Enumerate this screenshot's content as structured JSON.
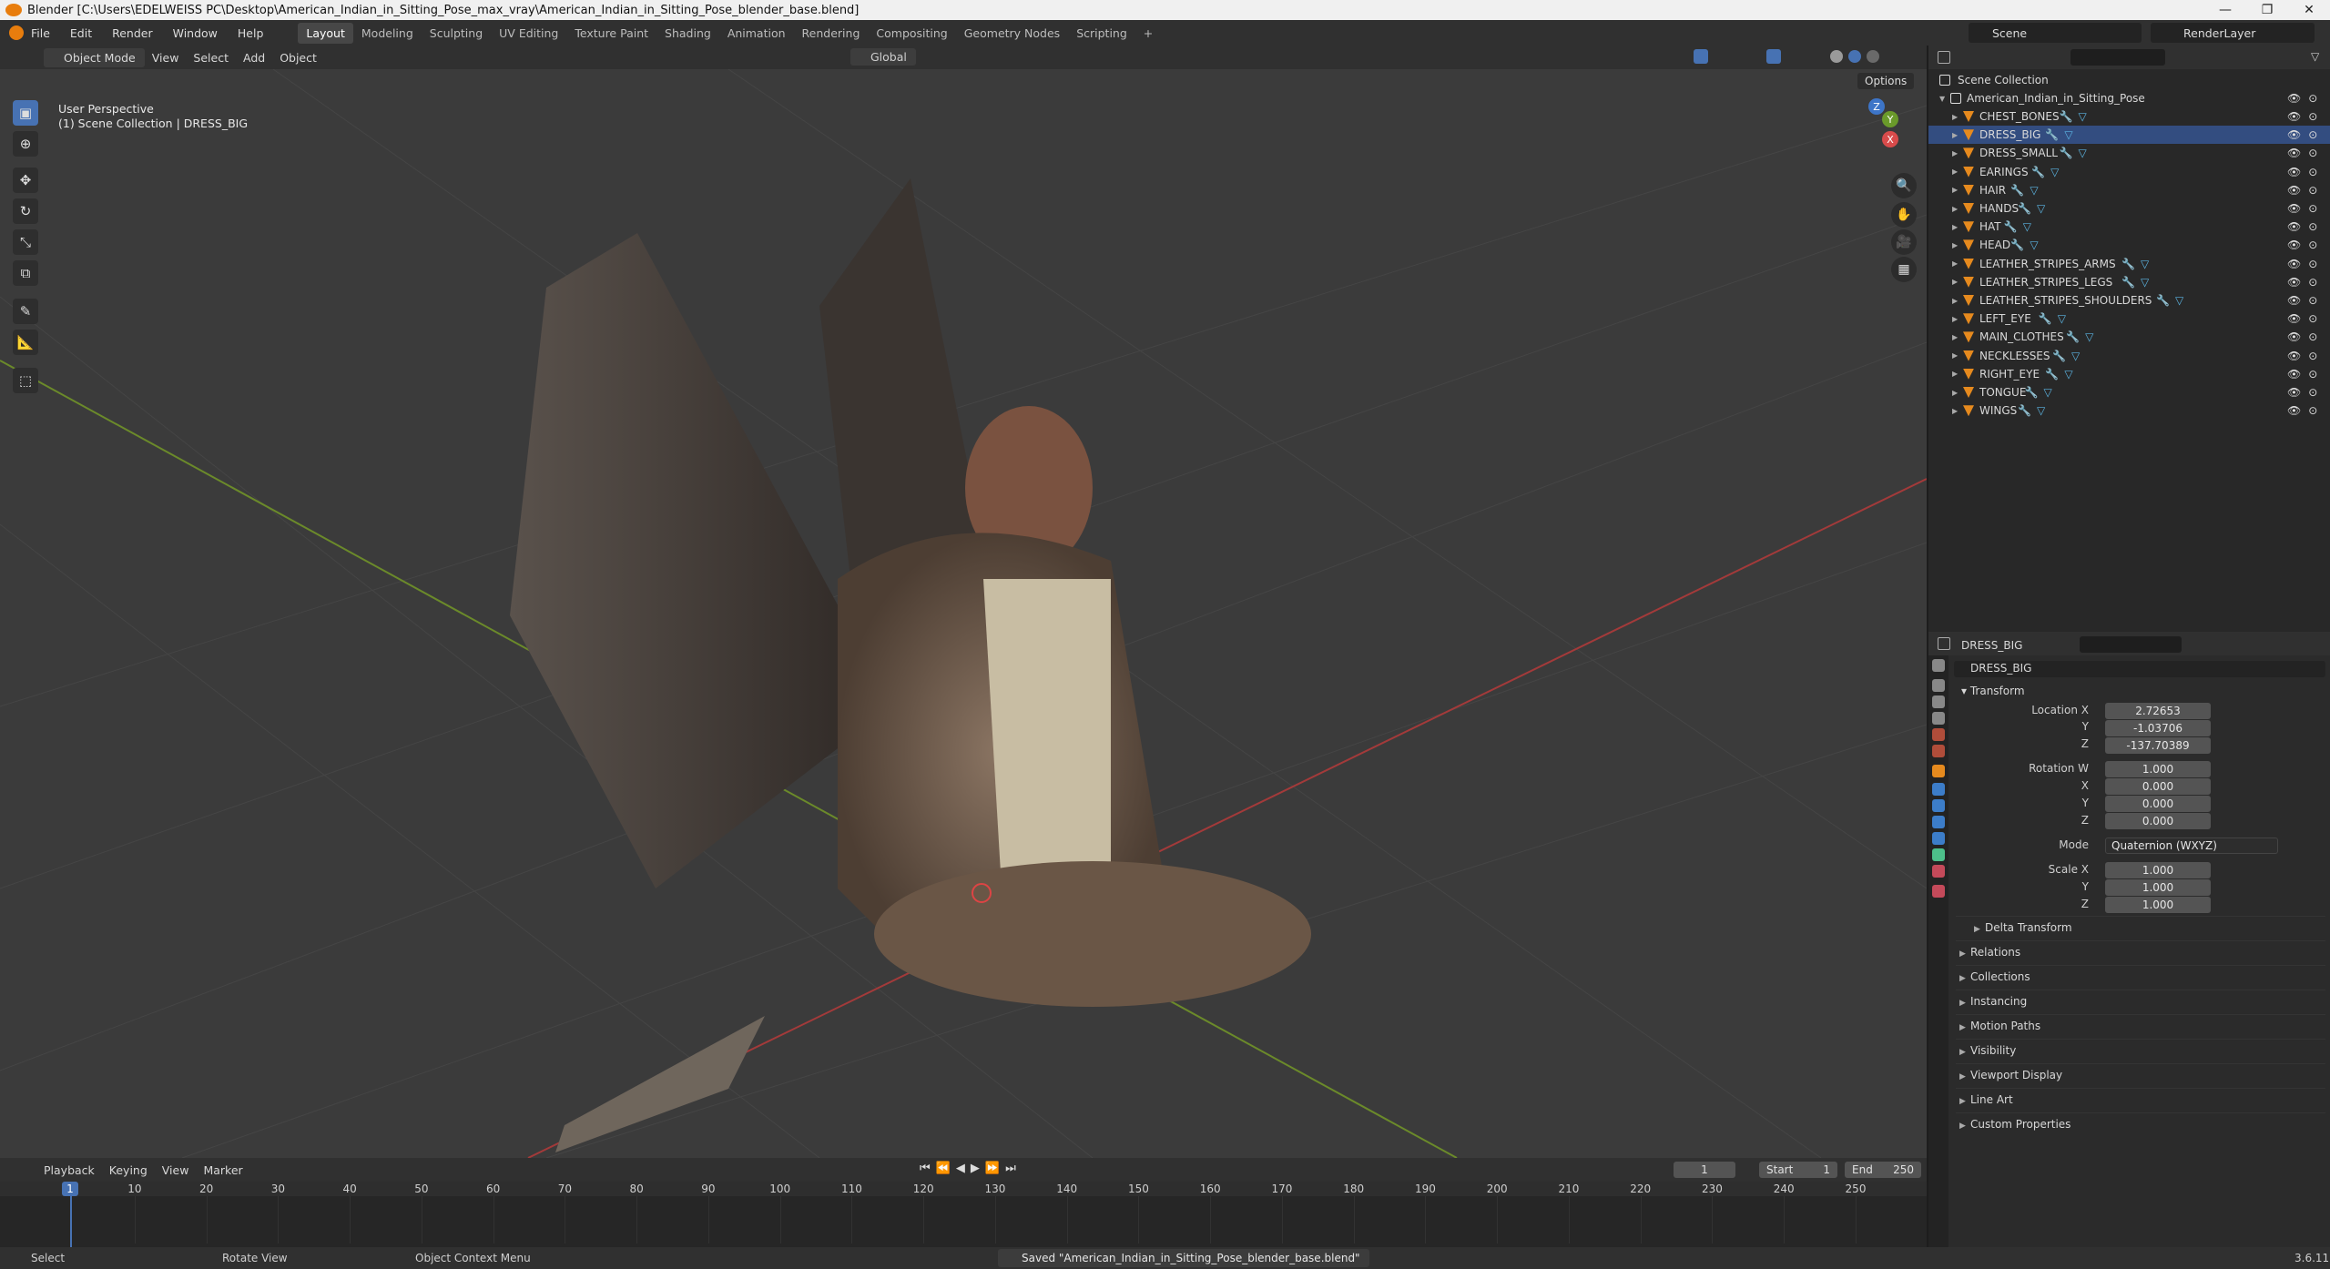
{
  "window": {
    "title": "Blender [C:\\Users\\EDELWEISS PC\\Desktop\\American_Indian_in_Sitting_Pose_max_vray\\American_Indian_in_Sitting_Pose_blender_base.blend]",
    "controls": [
      "—",
      "❐",
      "✕"
    ]
  },
  "menu": [
    "File",
    "Edit",
    "Render",
    "Window",
    "Help"
  ],
  "workspaces": [
    "Layout",
    "Modeling",
    "Sculpting",
    "UV Editing",
    "Texture Paint",
    "Shading",
    "Animation",
    "Rendering",
    "Compositing",
    "Geometry Nodes",
    "Scripting",
    "+"
  ],
  "scene": "Scene",
  "render_layer": "RenderLayer",
  "viewport_header": {
    "mode": "Object Mode",
    "menus": [
      "View",
      "Select",
      "Add",
      "Object"
    ],
    "transform": "Global",
    "options": "Options"
  },
  "viewport": {
    "perspective": "User Perspective",
    "collection": "(1) Scene Collection | DRESS_BIG"
  },
  "tools": [
    "select-box-icon",
    "cursor-icon",
    "move-icon",
    "rotate-icon",
    "scale-icon",
    "transform-icon",
    "annotate-icon",
    "measure-icon",
    "add-cube-icon"
  ],
  "nav_gizmo": [
    "X",
    "Y",
    "Z"
  ],
  "outliner": {
    "root": "Scene Collection",
    "collection": "American_Indian_in_Sitting_Pose",
    "items": [
      "CHEST_BONES",
      "DRESS_BIG",
      "DRESS_SMALL",
      "EARINGS",
      "HAIR",
      "HANDS",
      "HAT",
      "HEAD",
      "LEATHER_STRIPES_ARMS",
      "LEATHER_STRIPES_LEGS",
      "LEATHER_STRIPES_SHOULDERS",
      "LEFT_EYE",
      "MAIN_CLOTHES",
      "NECKLESSES",
      "RIGHT_EYE",
      "TONGUE",
      "WINGS"
    ]
  },
  "properties": {
    "object_name": "DRESS_BIG",
    "data_name": "DRESS_BIG",
    "transform_label": "Transform",
    "location": {
      "label": "Location X",
      "x": "2.72653",
      "y": "-1.03706",
      "z": "-137.70389"
    },
    "rotation": {
      "label": "Rotation W",
      "w": "1.000",
      "x": "0.000",
      "y": "0.000",
      "z": "0.000"
    },
    "mode": {
      "label": "Mode",
      "value": "Quaternion (WXYZ)"
    },
    "scale": {
      "label": "Scale X",
      "x": "1.000",
      "y": "1.000",
      "z": "1.000"
    },
    "axis_labels": {
      "y": "Y",
      "z": "Z",
      "x": "X"
    },
    "sections": [
      "Delta Transform",
      "Relations",
      "Collections",
      "Instancing",
      "Motion Paths",
      "Visibility",
      "Viewport Display",
      "Line Art",
      "Custom Properties"
    ]
  },
  "timeline": {
    "menus": [
      "Playback",
      "Keying",
      "View",
      "Marker"
    ],
    "current_frame": "1",
    "start_label": "Start",
    "start": "1",
    "end_label": "End",
    "end": "250",
    "ticks": [
      "10",
      "20",
      "30",
      "40",
      "50",
      "60",
      "70",
      "80",
      "90",
      "100",
      "110",
      "120",
      "130",
      "140",
      "150",
      "160",
      "170",
      "180",
      "190",
      "200",
      "210",
      "220",
      "230",
      "240",
      "250"
    ]
  },
  "statusbar": {
    "select": "Select",
    "rotate": "Rotate View",
    "context": "Object Context Menu",
    "saved": "Saved \"American_Indian_in_Sitting_Pose_blender_base.blend\"",
    "version": "3.6.11"
  }
}
